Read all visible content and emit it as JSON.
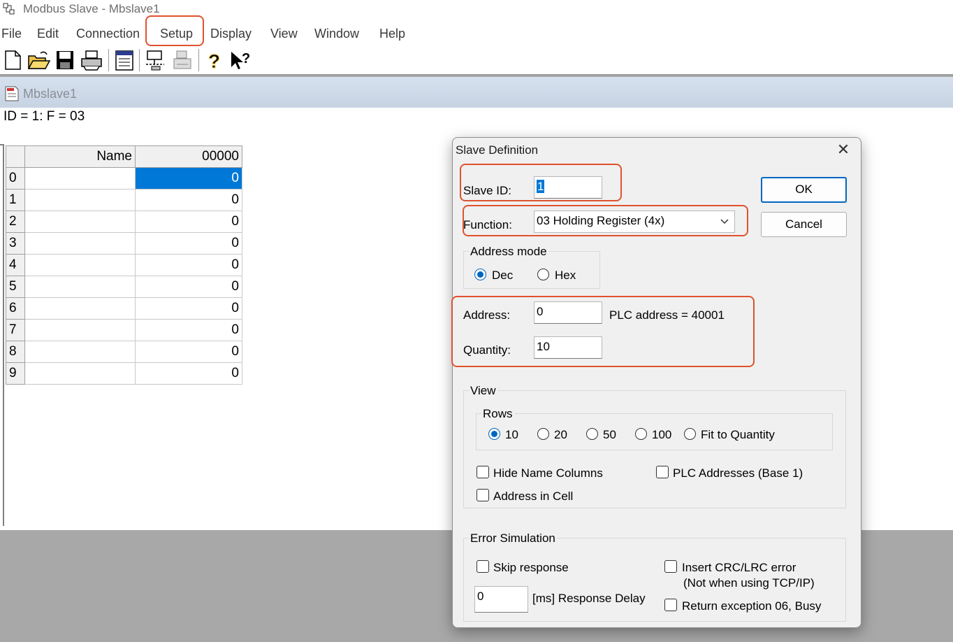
{
  "app": {
    "title": "Modbus Slave - Mbslave1"
  },
  "menu": [
    "File",
    "Edit",
    "Connection",
    "Setup",
    "Display",
    "View",
    "Window",
    "Help"
  ],
  "toolbar": {
    "buttons": [
      "new-icon",
      "open-icon",
      "save-icon",
      "print-icon",
      "window-icon",
      "connect-icon",
      "disconnect-icon",
      "help-icon",
      "context-help-icon"
    ]
  },
  "document": {
    "title": "Mbslave1",
    "header": "ID = 1: F = 03",
    "grid": {
      "col_name": "Name",
      "col_value": "00000",
      "rows": [
        {
          "idx": "0",
          "name": "",
          "value": "0"
        },
        {
          "idx": "1",
          "name": "",
          "value": "0"
        },
        {
          "idx": "2",
          "name": "",
          "value": "0"
        },
        {
          "idx": "3",
          "name": "",
          "value": "0"
        },
        {
          "idx": "4",
          "name": "",
          "value": "0"
        },
        {
          "idx": "5",
          "name": "",
          "value": "0"
        },
        {
          "idx": "6",
          "name": "",
          "value": "0"
        },
        {
          "idx": "7",
          "name": "",
          "value": "0"
        },
        {
          "idx": "8",
          "name": "",
          "value": "0"
        },
        {
          "idx": "9",
          "name": "",
          "value": "0"
        }
      ]
    }
  },
  "dialog": {
    "title": "Slave Definition",
    "close": "✕",
    "slave_id_label": "Slave ID:",
    "slave_id_value": "1",
    "function_label": "Function:",
    "function_value": "03 Holding Register (4x)",
    "ok": "OK",
    "cancel": "Cancel",
    "address_mode": {
      "title": "Address mode",
      "dec": "Dec",
      "hex": "Hex",
      "selected": "Dec"
    },
    "address_label": "Address:",
    "address_value": "0",
    "plc_address": "PLC address = 40001",
    "quantity_label": "Quantity:",
    "quantity_value": "10",
    "view": {
      "title": "View",
      "rows_title": "Rows",
      "rows_options": [
        "10",
        "20",
        "50",
        "100",
        "Fit to Quantity"
      ],
      "rows_selected": "10",
      "hide_name_columns": "Hide Name Columns",
      "plc_addresses": "PLC Addresses (Base 1)",
      "address_in_cell": "Address in Cell"
    },
    "error_sim": {
      "title": "Error Simulation",
      "skip_response": "Skip response",
      "insert_crc": "Insert CRC/LRC error",
      "insert_crc_note": "(Not when using TCP/IP)",
      "delay_value": "0",
      "delay_label": "[ms] Response Delay",
      "return_exception": "Return exception 06, Busy"
    }
  },
  "colors": {
    "accent": "#0067c0",
    "selection": "#0078d7",
    "highlight": "#e0522e"
  }
}
